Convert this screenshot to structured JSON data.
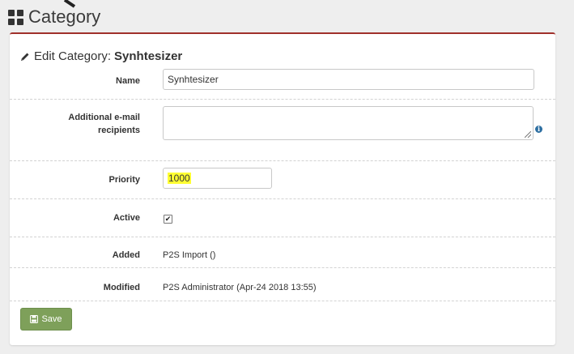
{
  "header": {
    "title": "Category",
    "icon": "grid-icon"
  },
  "panel": {
    "heading_prefix": "Edit Category:",
    "heading_name": "Synhtesizer",
    "accent_color": "#a0302b"
  },
  "form": {
    "name_label": "Name",
    "name_value": "Synhtesizer",
    "recipients_label": "Additional e-mail recipients",
    "recipients_value": "",
    "priority_label": "Priority",
    "priority_value": "1000",
    "active_label": "Active",
    "active_checked": true,
    "added_label": "Added",
    "added_value": "P2S Import ()",
    "modified_label": "Modified",
    "modified_value": "P2S Administrator (Apr-24 2018 13:55)"
  },
  "actions": {
    "save_label": "Save",
    "save_color": "#7ea05a"
  }
}
